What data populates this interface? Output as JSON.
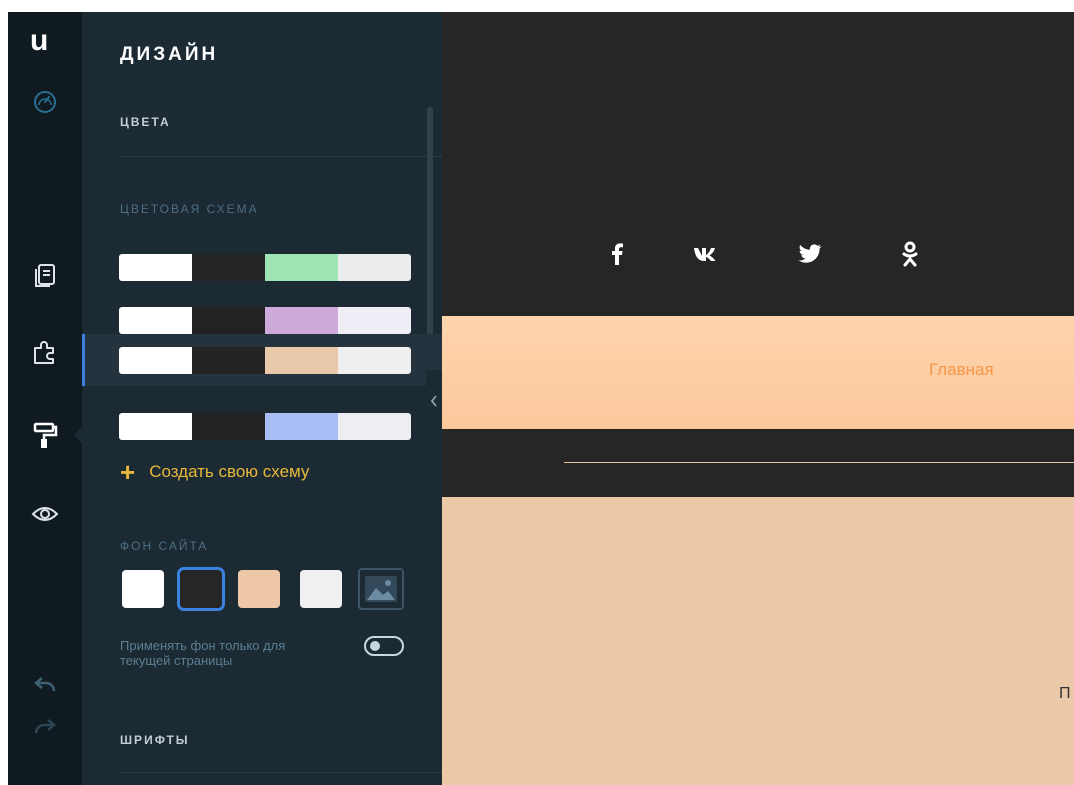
{
  "rail": {
    "logo": "u",
    "items": [
      {
        "icon": "speedometer-icon"
      },
      {
        "icon": "pages-icon"
      },
      {
        "icon": "puzzle-icon"
      },
      {
        "icon": "paint-roller-icon",
        "active": true
      },
      {
        "icon": "eye-icon"
      },
      {
        "icon": "undo-icon"
      },
      {
        "icon": "redo-icon"
      }
    ]
  },
  "panel": {
    "title": "ДИЗАЙН",
    "colors_section": "ЦВЕТА",
    "scheme_label": "ЦВЕТОВАЯ СХЕМА",
    "schemes": [
      {
        "colors": [
          "#ffffff",
          "#222425",
          "#9fe5b4",
          "#eceeed"
        ],
        "selected": false
      },
      {
        "colors": [
          "#ffffff",
          "#222225",
          "#cea9dc",
          "#efedf5"
        ],
        "selected": false
      },
      {
        "colors": [
          "#ffffff",
          "#232323",
          "#e9c8a9",
          "#efefef"
        ],
        "selected": true
      },
      {
        "colors": [
          "#ffffff",
          "#222325",
          "#a8bef5",
          "#eceef4"
        ],
        "selected": false
      }
    ],
    "create_scheme": "Создать свою схему",
    "bg_label": "ФОН САЙТА",
    "bg_swatches": [
      {
        "color": "#ffffff",
        "selected": false
      },
      {
        "color": "#262626",
        "selected": true
      },
      {
        "color": "#eec7a6",
        "selected": false
      },
      {
        "color": "#f1f0f0",
        "selected": false
      }
    ],
    "apply_bg_text": "Применять фон только для текущей страницы",
    "fonts_section": "ШРИФТЫ"
  },
  "preview": {
    "social": [
      "f",
      "vk",
      "twitter",
      "ok"
    ],
    "nav_link": "Главная",
    "content_letter": "П"
  },
  "colors": {
    "rail_bg": "#0f1a21",
    "panel_bg": "#1c2a34",
    "accent_blue": "#3b82e0",
    "accent_yellow": "#e8b83a",
    "label_blue": "#4e6e84",
    "label_light": "#c3ced6"
  }
}
